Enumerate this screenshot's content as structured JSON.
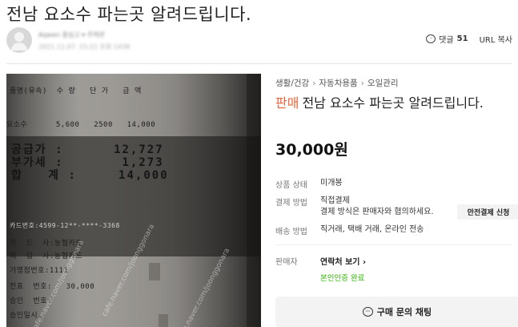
{
  "post": {
    "title": "전남 요소수 파는곳 알려드립니다."
  },
  "author": {
    "nickname": "Aqwen 중심고 ▾ 주택관",
    "meta": "2021.11.07. 15:22 조회 1438"
  },
  "tools": {
    "comment_label": "댓글",
    "comment_count": "51",
    "url_copy": "URL 복사"
  },
  "receipt": {
    "header": "품명(유속)  수 량   단 가   금 액",
    "item_line": "요소수      5,600   2500   14,000",
    "supply": "공급가 :      12,727",
    "vat": "부가세 :       1,273",
    "total": "합   계 :     14,000",
    "card_line": "카드번호:4599-12**-****-3368",
    "lines": [
      "카  드  사:농협카드",
      "매  입  사:농협카드",
      "가맹점번호:1111",
      "전표  번호:   30,000",
      "승인  번호:",
      "승인일시"
    ],
    "watermark": "cafe.naver.com/joonggonara"
  },
  "product": {
    "breadcrumb": [
      "생활/건강",
      "자동차용품",
      "오일관리"
    ],
    "badge": "판매",
    "title": "전남 요소수 파는곳 알려드립니다.",
    "price": "30,000원",
    "condition_label": "상품 상태",
    "condition_value": "미개봉",
    "payment_label": "결제 방법",
    "payment_value": "직접결제",
    "payment_note": "결제 방식은 판매자와 협의하세요.",
    "safe_pay_button": "안전결제 신청",
    "delivery_label": "배송 방법",
    "delivery_value": "직거래, 택배 거래, 온라인 전송",
    "seller_label": "판매자",
    "contact_link": "연락처 보기 ›",
    "verified": "본인인증 완료",
    "chat_button": "구매 문의 채팅"
  },
  "colors": {
    "badge": "#e8643b",
    "verified": "#2db400"
  }
}
